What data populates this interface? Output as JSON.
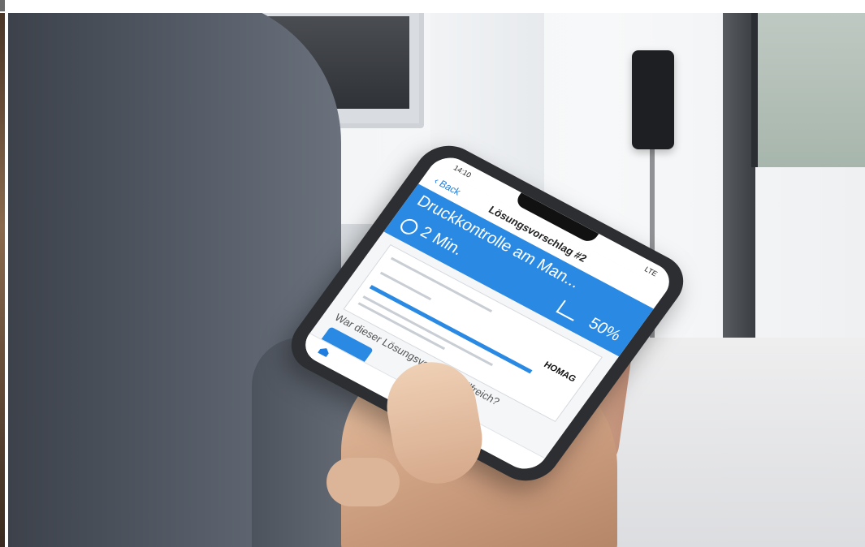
{
  "phone_app": {
    "status_time": "14:10",
    "status_network": "LTE",
    "nav_back": "Back",
    "nav_title": "Lösungsvorschlag #2",
    "banner_heading": "Druckkontrolle am Man...",
    "banner_duration": "2 Min.",
    "banner_percent": "50%",
    "document_logo": "HOMAG",
    "question": "War dieser Lösungsvorschlag hilfreich?"
  },
  "icons": [
    "back-chevron-icon",
    "clock-icon",
    "chart-icon",
    "home-icon"
  ],
  "colors": {
    "accent": "#2a8ae3",
    "phone_body": "#2c2e31"
  }
}
